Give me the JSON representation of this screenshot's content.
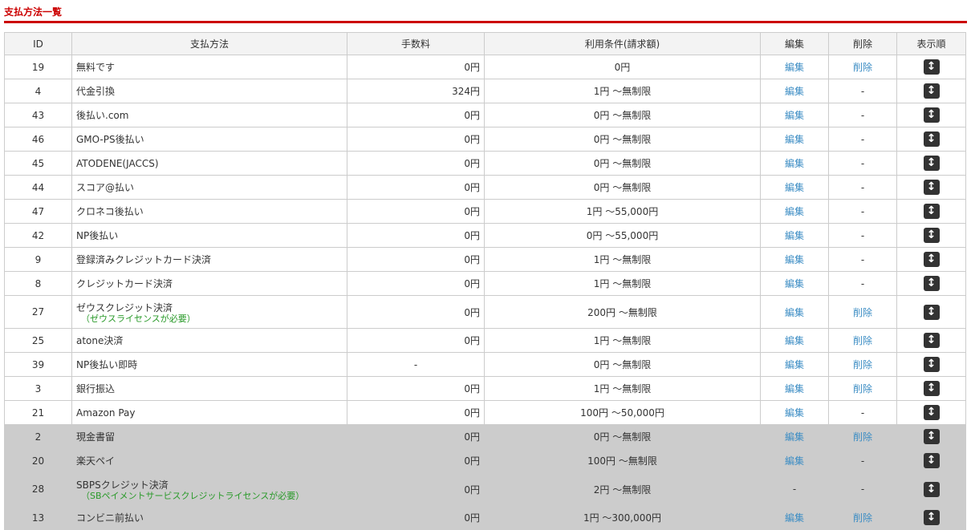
{
  "title": "支払方法一覧",
  "headers": {
    "id": "ID",
    "name": "支払方法",
    "fee": "手数料",
    "cond": "利用条件(請求額)",
    "edit": "編集",
    "del": "削除",
    "order": "表示順"
  },
  "rows": [
    {
      "id": "19",
      "name": "無料です",
      "fee": "0円",
      "cond": "0円",
      "edit": "編集",
      "del": "削除",
      "off": false
    },
    {
      "id": "4",
      "name": "代金引換",
      "fee": "324円",
      "cond": "1円 ～無制限",
      "edit": "編集",
      "del": "-",
      "off": false
    },
    {
      "id": "43",
      "name": "後払い.com",
      "fee": "0円",
      "cond": "0円 ～無制限",
      "edit": "編集",
      "del": "-",
      "off": false
    },
    {
      "id": "46",
      "name": "GMO-PS後払い",
      "fee": "0円",
      "cond": "0円 ～無制限",
      "edit": "編集",
      "del": "-",
      "off": false
    },
    {
      "id": "45",
      "name": "ATODENE(JACCS)",
      "fee": "0円",
      "cond": "0円 ～無制限",
      "edit": "編集",
      "del": "-",
      "off": false
    },
    {
      "id": "44",
      "name": "スコア@払い",
      "fee": "0円",
      "cond": "0円 ～無制限",
      "edit": "編集",
      "del": "-",
      "off": false
    },
    {
      "id": "47",
      "name": "クロネコ後払い",
      "fee": "0円",
      "cond": "1円 ～55,000円",
      "edit": "編集",
      "del": "-",
      "off": false
    },
    {
      "id": "42",
      "name": "NP後払い",
      "fee": "0円",
      "cond": "0円 ～55,000円",
      "edit": "編集",
      "del": "-",
      "off": false
    },
    {
      "id": "9",
      "name": "登録済みクレジットカード決済",
      "fee": "0円",
      "cond": "1円 ～無制限",
      "edit": "編集",
      "del": "-",
      "off": false
    },
    {
      "id": "8",
      "name": "クレジットカード決済",
      "fee": "0円",
      "cond": "1円 ～無制限",
      "edit": "編集",
      "del": "-",
      "off": false
    },
    {
      "id": "27",
      "name": "ゼウスクレジット決済",
      "note": "（ゼウスライセンスが必要）",
      "fee": "0円",
      "cond": "200円 ～無制限",
      "edit": "編集",
      "del": "削除",
      "off": false
    },
    {
      "id": "25",
      "name": "atone決済",
      "fee": "0円",
      "cond": "1円 ～無制限",
      "edit": "編集",
      "del": "削除",
      "off": false
    },
    {
      "id": "39",
      "name": "NP後払い即時",
      "fee": "-",
      "cond": "0円 ～無制限",
      "edit": "編集",
      "del": "削除",
      "off": false
    },
    {
      "id": "3",
      "name": "銀行振込",
      "fee": "0円",
      "cond": "1円 ～無制限",
      "edit": "編集",
      "del": "削除",
      "off": false
    },
    {
      "id": "21",
      "name": "Amazon Pay",
      "fee": "0円",
      "cond": "100円 ～50,000円",
      "edit": "編集",
      "del": "-",
      "off": false
    },
    {
      "id": "2",
      "name": "現金書留",
      "fee": "0円",
      "cond": "0円 ～無制限",
      "edit": "編集",
      "del": "削除",
      "off": true
    },
    {
      "id": "20",
      "name": "楽天ペイ",
      "fee": "0円",
      "cond": "100円 ～無制限",
      "edit": "編集",
      "del": "-",
      "off": true
    },
    {
      "id": "28",
      "name": "SBPSクレジット決済",
      "note": "（SBペイメントサービスクレジットライセンスが必要）",
      "fee": "0円",
      "cond": "2円 ～無制限",
      "edit": "-",
      "del": "-",
      "off": true
    },
    {
      "id": "13",
      "name": "コンビニ前払い",
      "fee": "0円",
      "cond": "1円 ～300,000円",
      "edit": "編集",
      "del": "削除",
      "off": true
    }
  ]
}
